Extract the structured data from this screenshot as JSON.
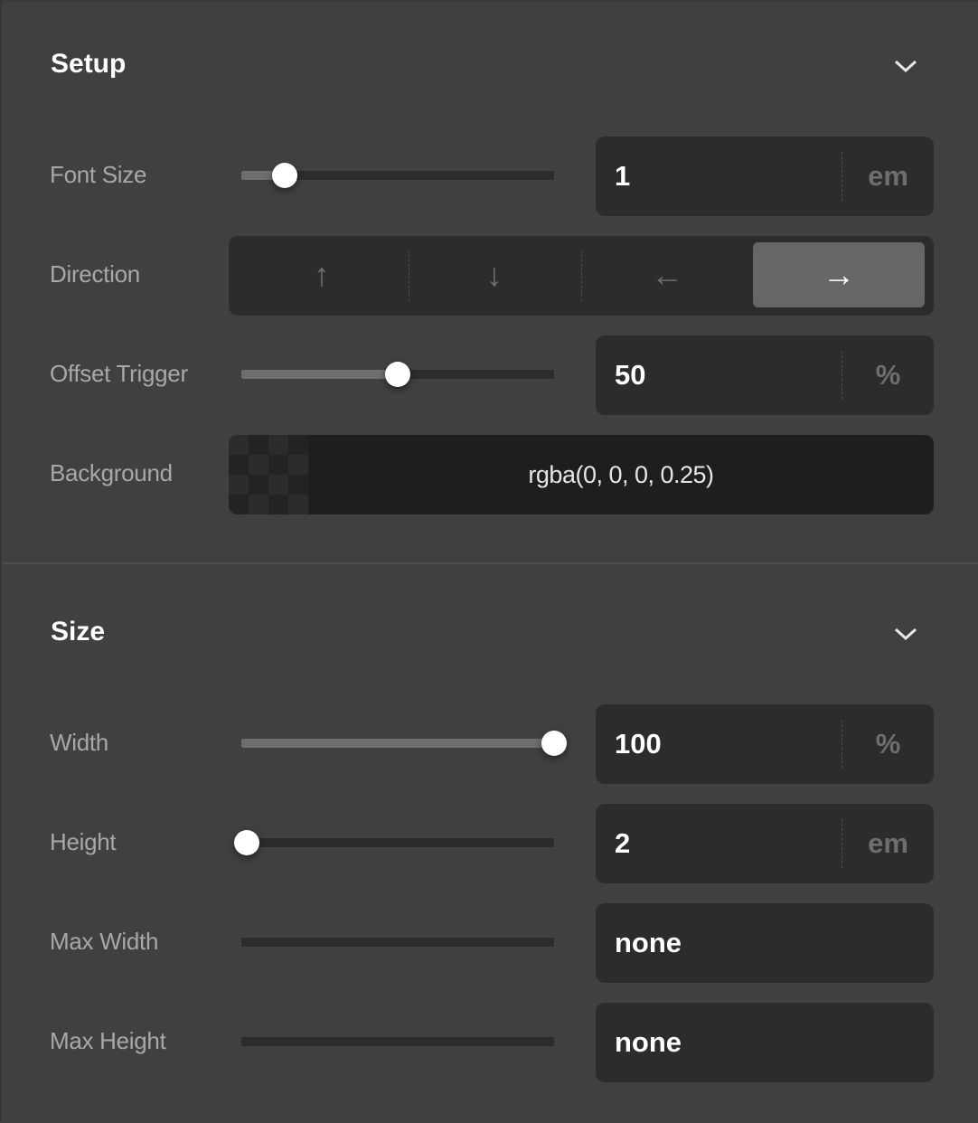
{
  "sections": {
    "setup": {
      "title": "Setup",
      "toggle_icon": "chevron-down-icon",
      "font_size": {
        "label": "Font Size",
        "slider_fraction": 0.14,
        "value": "1",
        "unit": "em"
      },
      "direction": {
        "label": "Direction",
        "options": [
          {
            "icon": "arrow-up-icon",
            "glyph": "↑",
            "active": false
          },
          {
            "icon": "arrow-down-icon",
            "glyph": "↓",
            "active": false
          },
          {
            "icon": "arrow-left-icon",
            "glyph": "←",
            "active": false
          },
          {
            "icon": "arrow-right-icon",
            "glyph": "→",
            "active": true
          }
        ]
      },
      "offset_trigger": {
        "label": "Offset Trigger",
        "slider_fraction": 0.5,
        "value": "50",
        "unit": "%"
      },
      "background": {
        "label": "Background",
        "value": "rgba(0, 0, 0, 0.25)"
      }
    },
    "size": {
      "title": "Size",
      "toggle_icon": "chevron-down-icon",
      "width": {
        "label": "Width",
        "slider_fraction": 1.0,
        "value": "100",
        "unit": "%"
      },
      "height": {
        "label": "Height",
        "slider_fraction": 0.0,
        "value": "2",
        "unit": "em"
      },
      "max_width": {
        "label": "Max Width",
        "value": "none"
      },
      "max_height": {
        "label": "Max Height",
        "value": "none"
      }
    }
  }
}
